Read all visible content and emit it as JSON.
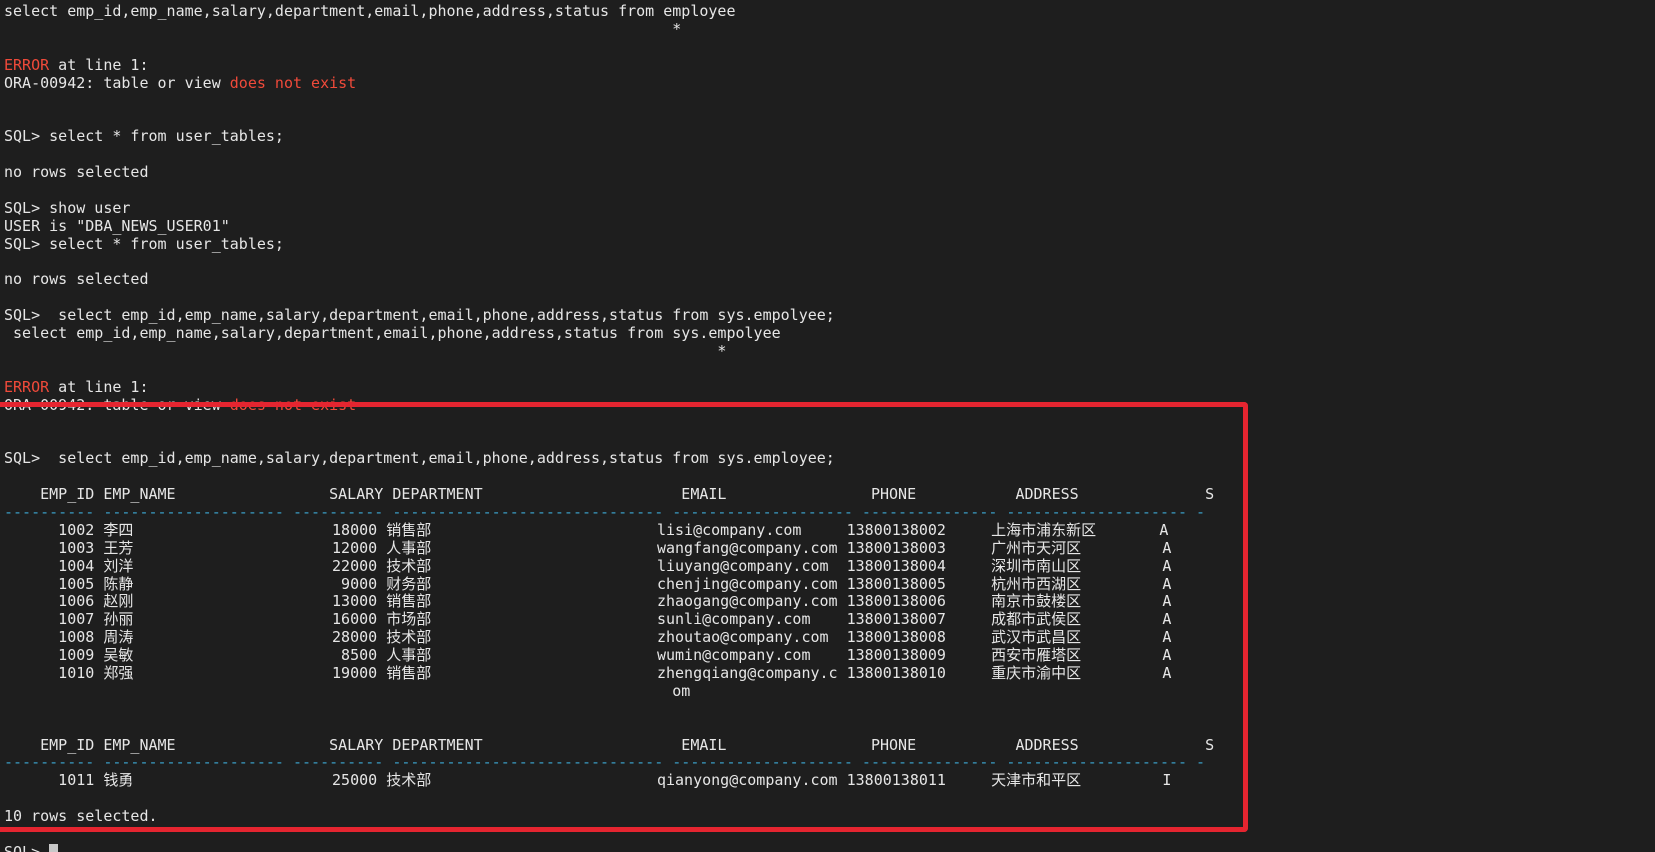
{
  "terminal": {
    "lines": [
      [
        {
          "t": "select emp_id,emp_name,salary,department,email,phone,address,status from employee"
        }
      ],
      [
        {
          "t": "                                                                          *"
        }
      ],
      [
        {
          "t": ""
        }
      ],
      [
        {
          "t": "ERROR",
          "c": "err"
        },
        {
          "t": " at line 1:"
        }
      ],
      [
        {
          "t": "ORA-00942: table or view "
        },
        {
          "t": "does not exist",
          "c": "err"
        }
      ],
      [
        {
          "t": ""
        }
      ],
      [
        {
          "t": ""
        }
      ],
      [
        {
          "t": "SQL> select * from user_tables;"
        }
      ],
      [
        {
          "t": ""
        }
      ],
      [
        {
          "t": "no rows selected"
        }
      ],
      [
        {
          "t": ""
        }
      ],
      [
        {
          "t": "SQL> show user"
        }
      ],
      [
        {
          "t": "USER is \"DBA_NEWS_USER01\""
        }
      ],
      [
        {
          "t": "SQL> select * from user_tables;"
        }
      ],
      [
        {
          "t": ""
        }
      ],
      [
        {
          "t": "no rows selected"
        }
      ],
      [
        {
          "t": ""
        }
      ],
      [
        {
          "t": "SQL>  select emp_id,emp_name,salary,department,email,phone,address,status from sys.empolyee;"
        }
      ],
      [
        {
          "t": " select emp_id,emp_name,salary,department,email,phone,address,status from sys.empolyee"
        }
      ],
      [
        {
          "t": "                                                                               *"
        }
      ],
      [
        {
          "t": ""
        }
      ],
      [
        {
          "t": "ERROR",
          "c": "err"
        },
        {
          "t": " at line 1:"
        }
      ],
      [
        {
          "t": "ORA-00942: table or view "
        },
        {
          "t": "does not exist",
          "c": "err"
        }
      ],
      [
        {
          "t": ""
        }
      ],
      [
        {
          "t": ""
        }
      ],
      [
        {
          "t": "SQL>  select emp_id,emp_name,salary,department,email,phone,address,status from sys.employee;"
        }
      ],
      [
        {
          "t": ""
        }
      ],
      [
        {
          "t": "    EMP_ID EMP_NAME                 SALARY DEPARTMENT                      EMAIL                PHONE           ADDRESS              S"
        }
      ],
      [
        {
          "t": "---------- -------------------- ---------- ------------------------------ -------------------- --------------- -------------------- -",
          "c": "sep"
        }
      ],
      [
        {
          "t": "      1002 李四                      18000 销售部                         lisi@company.com     13800138002     上海市浦东新区       A"
        }
      ],
      [
        {
          "t": "      1003 王芳                      12000 人事部                         wangfang@company.com 13800138003     广州市天河区         A"
        }
      ],
      [
        {
          "t": "      1004 刘洋                      22000 技术部                         liuyang@company.com  13800138004     深圳市南山区         A"
        }
      ],
      [
        {
          "t": "      1005 陈静                       9000 财务部                         chenjing@company.com 13800138005     杭州市西湖区         A"
        }
      ],
      [
        {
          "t": "      1006 赵刚                      13000 销售部                         zhaogang@company.com 13800138006     南京市鼓楼区         A"
        }
      ],
      [
        {
          "t": "      1007 孙丽                      16000 市场部                         sunli@company.com    13800138007     成都市武侯区         A"
        }
      ],
      [
        {
          "t": "      1008 周涛                      28000 技术部                         zhoutao@company.com  13800138008     武汉市武昌区         A"
        }
      ],
      [
        {
          "t": "      1009 吴敏                       8500 人事部                         wumin@company.com    13800138009     西安市雁塔区         A"
        }
      ],
      [
        {
          "t": "      1010 郑强                      19000 销售部                         zhengqiang@company.c 13800138010     重庆市渝中区         A"
        }
      ],
      [
        {
          "t": "                                                                          om"
        }
      ],
      [
        {
          "t": ""
        }
      ],
      [
        {
          "t": ""
        }
      ],
      [
        {
          "t": "    EMP_ID EMP_NAME                 SALARY DEPARTMENT                      EMAIL                PHONE           ADDRESS              S"
        }
      ],
      [
        {
          "t": "---------- -------------------- ---------- ------------------------------ -------------------- --------------- -------------------- -",
          "c": "sep"
        }
      ],
      [
        {
          "t": "      1011 钱勇                      25000 技术部                         qianyong@company.com 13800138011     天津市和平区         I"
        }
      ],
      [
        {
          "t": ""
        }
      ],
      [
        {
          "t": "10 rows selected."
        }
      ],
      [
        {
          "t": ""
        }
      ],
      [
        {
          "t": "SQL> "
        },
        {
          "cursor": true
        }
      ]
    ]
  }
}
